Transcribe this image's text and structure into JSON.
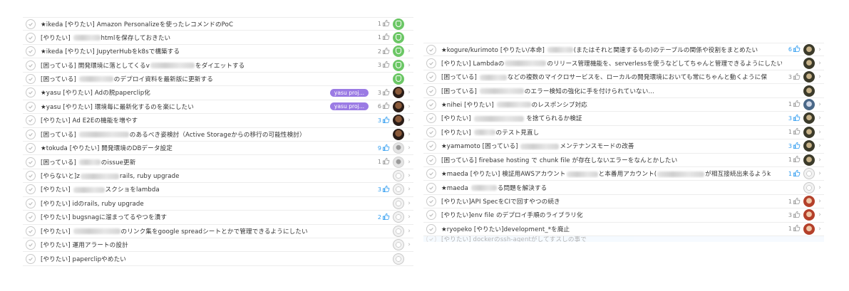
{
  "left_list": [
    {
      "parts": [
        {
          "t": "★ikeda [やりたい] Amazon Personalizeを使ったレコメンドのPoC"
        }
      ],
      "likes": "1",
      "likes_blue": false,
      "avatar": "green",
      "chevron": false
    },
    {
      "parts": [
        {
          "t": "[やりたい] "
        },
        {
          "blur": true
        },
        {
          "t": "htmlを保存しておきたい"
        }
      ],
      "likes": "1",
      "likes_blue": false,
      "avatar": "green",
      "chevron": false
    },
    {
      "parts": [
        {
          "t": "★ikeda [やりたい] JupyterHubをk8sで構築する"
        }
      ],
      "likes": "2",
      "likes_blue": false,
      "avatar": "green",
      "chevron": true
    },
    {
      "parts": [
        {
          "t": "[困っている] 開発環境に落としてくるv"
        },
        {
          "blur": true
        },
        {
          "t": "をダイエットする"
        }
      ],
      "likes": "3",
      "likes_blue": false,
      "avatar": "green",
      "chevron": true
    },
    {
      "parts": [
        {
          "t": "[困っている] "
        },
        {
          "blur": true
        },
        {
          "t": "のデプロイ資料を最新版に更新する"
        }
      ],
      "likes": "",
      "likes_blue": false,
      "avatar": "green",
      "chevron": false
    },
    {
      "parts": [
        {
          "t": "★yasu [やりたい] Adの脱paperclip化"
        }
      ],
      "tag": "yasu proj...",
      "likes": "3",
      "likes_blue": false,
      "avatar": "dark",
      "chevron": true
    },
    {
      "parts": [
        {
          "t": "★yasu [やりたい] 環境毎に最新化するのを楽にしたい"
        }
      ],
      "tag": "yasu proj...",
      "likes": "6",
      "likes_blue": false,
      "avatar": "dark",
      "chevron": true
    },
    {
      "parts": [
        {
          "t": "[やりたい] Ad E2Eの機能を増やす"
        }
      ],
      "likes": "3",
      "likes_blue": true,
      "avatar": "dark",
      "chevron": true
    },
    {
      "parts": [
        {
          "t": "[困っている] "
        },
        {
          "blur": true
        },
        {
          "t": "のあるべき姿検討（Active Storageからの移行の可能性検討）"
        }
      ],
      "likes": "",
      "likes_blue": false,
      "avatar": "dark",
      "chevron": true
    },
    {
      "parts": [
        {
          "t": "★tokuda [やりたい] 開発環境のDBデータ設定"
        }
      ],
      "likes": "9",
      "likes_blue": true,
      "avatar": "grey",
      "chevron": true
    },
    {
      "parts": [
        {
          "t": "[困っている] "
        },
        {
          "blur": true
        },
        {
          "t": "のissue更新"
        }
      ],
      "likes": "1",
      "likes_blue": false,
      "avatar": "grey",
      "chevron": true
    },
    {
      "parts": [
        {
          "t": "[やらないと]z"
        },
        {
          "blur": true
        },
        {
          "t": "rails, ruby upgrade"
        }
      ],
      "likes": "",
      "likes_blue": false,
      "avatar": "sketch",
      "chevron": true
    },
    {
      "parts": [
        {
          "t": "[やりたい] "
        },
        {
          "blur": true
        },
        {
          "t": "スクショをlambda"
        }
      ],
      "likes": "3",
      "likes_blue": true,
      "avatar": "sketch",
      "chevron": true
    },
    {
      "parts": [
        {
          "t": "[やりたい] idのrails, ruby upgrade"
        }
      ],
      "likes": "",
      "likes_blue": false,
      "avatar": "sketch",
      "chevron": true
    },
    {
      "parts": [
        {
          "t": "[やりたい] bugsnagに溜まってるやつを潰す"
        }
      ],
      "likes": "2",
      "likes_blue": true,
      "avatar": "sketch",
      "chevron": true
    },
    {
      "parts": [
        {
          "t": "[やりたい] "
        },
        {
          "blur": true
        },
        {
          "t": "のリンク集をgoogle spreadシートとかで管理できるようにしたい"
        }
      ],
      "likes": "",
      "likes_blue": false,
      "avatar": "sketch",
      "chevron": true
    },
    {
      "parts": [
        {
          "t": "[やりたい] 運用アラートの設計"
        }
      ],
      "likes": "",
      "likes_blue": false,
      "avatar": "sketch",
      "chevron": true
    },
    {
      "parts": [
        {
          "t": "[やりたい] paperclipやめたい"
        }
      ],
      "likes": "",
      "likes_blue": false,
      "avatar": "sketch",
      "chevron": false
    }
  ],
  "right_list": [
    {
      "parts": [
        {
          "t": "★kogure/kurimoto [やりたい/本命] "
        },
        {
          "blur": true
        },
        {
          "t": "(またはそれと関連するもの)のテーブルの関係や役割をまとめたい"
        }
      ],
      "likes": "6",
      "likes_blue": true,
      "avatar": "olive",
      "chevron": true
    },
    {
      "parts": [
        {
          "t": "[やりたい] Lambdaの"
        },
        {
          "blur": true
        },
        {
          "t": "のリリース管理機能を、serverlessを使うなどしてちゃんと管理できるようにしたい"
        }
      ],
      "likes": "",
      "likes_blue": false,
      "avatar": "olive",
      "chevron": true
    },
    {
      "parts": [
        {
          "t": "[困っている] "
        },
        {
          "blur": true
        },
        {
          "t": "などの複数のマイクロサービスを、ローカルの開発環境においても常にちゃんと動くように保"
        }
      ],
      "likes": "3",
      "likes_blue": false,
      "avatar": "olive",
      "chevron": true
    },
    {
      "parts": [
        {
          "t": "[困っている] "
        },
        {
          "blur": true
        },
        {
          "t": "のエラー検知の強化に手を付けられていない..."
        }
      ],
      "likes": "",
      "likes_blue": false,
      "avatar": "olive",
      "chevron": false
    },
    {
      "parts": [
        {
          "t": "★nihei [やりたい] "
        },
        {
          "blur": true
        },
        {
          "t": "のレスポンシブ対応"
        }
      ],
      "likes": "1",
      "likes_blue": false,
      "avatar": "blue",
      "chevron": true
    },
    {
      "parts": [
        {
          "t": "[やりたい] "
        },
        {
          "blur": true
        },
        {
          "t": " を捨てられるか検証"
        }
      ],
      "likes": "3",
      "likes_blue": true,
      "avatar": "olive",
      "chevron": true
    },
    {
      "parts": [
        {
          "t": "[やりたい] "
        },
        {
          "blur": true
        },
        {
          "t": "のテスト見直し"
        }
      ],
      "likes": "1",
      "likes_blue": false,
      "avatar": "olive",
      "chevron": true
    },
    {
      "parts": [
        {
          "t": "★yamamoto [困っている] "
        },
        {
          "blur": true
        },
        {
          "t": "メンテナンスモードの改善"
        }
      ],
      "likes": "3",
      "likes_blue": true,
      "avatar": "olive",
      "chevron": true
    },
    {
      "parts": [
        {
          "t": "[困っている] firebase hosting で chunk file が存在しないエラーをなんとかしたい"
        }
      ],
      "likes": "1",
      "likes_blue": false,
      "avatar": "olive",
      "chevron": true
    },
    {
      "parts": [
        {
          "t": "★maeda [やりたい] 検証用AWSアカウント"
        },
        {
          "blur": true
        },
        {
          "t": "と本番用アカウント("
        },
        {
          "blur": true
        },
        {
          "t": "が相互接続出来るようk"
        }
      ],
      "likes": "1",
      "likes_blue": true,
      "avatar": "sketch",
      "chevron": true
    },
    {
      "parts": [
        {
          "t": "★maeda "
        },
        {
          "blur": true
        },
        {
          "t": "る問題を解決する"
        }
      ],
      "likes": "",
      "likes_blue": false,
      "avatar": "sketch",
      "chevron": true
    },
    {
      "parts": [
        {
          "t": "[やりたい]API SpecをCIで回すやつの続き"
        }
      ],
      "likes": "1",
      "likes_blue": false,
      "avatar": "red",
      "chevron": true
    },
    {
      "parts": [
        {
          "t": "[やりたい]env file のデプロイ手順のライブラリ化"
        }
      ],
      "likes": "3",
      "likes_blue": false,
      "avatar": "red",
      "chevron": true
    },
    {
      "parts": [
        {
          "t": "★ryopeko [やりたい]development_*を廃止"
        }
      ],
      "likes": "1",
      "likes_blue": false,
      "avatar": "red",
      "chevron": true
    },
    {
      "parts": [
        {
          "t": "[やりたい] dockerのssh-agentがしてすスしの事で"
        }
      ],
      "likes": "",
      "likes_blue": false,
      "avatar": "empty",
      "chevron": false,
      "partial": true
    }
  ]
}
